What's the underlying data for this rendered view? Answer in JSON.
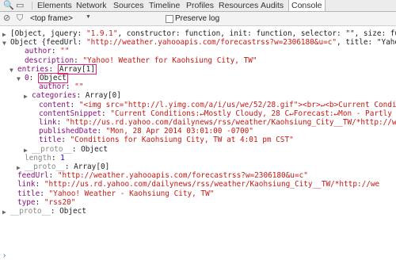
{
  "tabs": [
    "Elements",
    "Network",
    "Sources",
    "Timeline",
    "Profiles",
    "Resources",
    "Audits",
    "Console"
  ],
  "toolbar": {
    "frame": "<top frame>",
    "preserve_log": "Preserve log"
  },
  "lines": [
    {
      "ind": 1,
      "arrow": "right",
      "pre": "[Object, jquery: ",
      "val": "\"1.9.1\"",
      "vc": "s",
      "post": ", constructor: function, init: function, selector: \"\", size: fu"
    },
    {
      "ind": 1,
      "arrow": "down",
      "pre": "Object {feedUrl: ",
      "val": "\"http://weather.yahooapis.com/forecastrss?w=2306180&u=c\"",
      "vc": "s",
      "post": ", title: \"Yaho"
    },
    {
      "ind": 3,
      "key": "author",
      "val": "\"\"",
      "vc": "s"
    },
    {
      "ind": 3,
      "key": "description",
      "val": "\"Yahoo! Weather for Kaohsiung City, TW\"",
      "vc": "s"
    },
    {
      "ind": 2,
      "arrow": "down",
      "key": "entries",
      "val": "Array[1]",
      "vc": "hl"
    },
    {
      "ind": 3,
      "arrow": "down",
      "key": "0",
      "val": "Object",
      "vc": "hl"
    },
    {
      "ind": 5,
      "key": "author",
      "val": "\"\"",
      "vc": "s"
    },
    {
      "ind": 4,
      "arrow": "right",
      "key": "categories",
      "val": "Array[0]",
      "vc": ""
    },
    {
      "ind": 5,
      "key": "content",
      "val": "\"<img src=\"http://l.yimg.com/a/i/us/we/52/28.gif\"><br>↵<b>Current Conditi",
      "vc": "s"
    },
    {
      "ind": 5,
      "key": "contentSnippet",
      "val": "\"Current Conditions:↵Mostly Cloudy, 28 C↵Forecast:↵Mon - Partly",
      "vc": "s"
    },
    {
      "ind": 5,
      "key": "link",
      "val": "\"http://us.rd.yahoo.com/dailynews/rss/weather/Kaohsiung_City__TW/*http://w",
      "vc": "s"
    },
    {
      "ind": 5,
      "key": "publishedDate",
      "val": "\"Mon, 28 Apr 2014 03:01:00 -0700\"",
      "vc": "s"
    },
    {
      "ind": 5,
      "key": "title",
      "val": "\"Conditions for Kaohsiung City, TW at 4:01 pm CST\"",
      "vc": "s"
    },
    {
      "ind": 4,
      "arrow": "right",
      "key": "__proto__",
      "val": "Object",
      "vc": "",
      "kc": "dim"
    },
    {
      "ind": 3,
      "key": "length",
      "val": "1",
      "vc": "n",
      "kc": "dim"
    },
    {
      "ind": 3,
      "arrow": "right",
      "key": "__proto__",
      "val": "Array[0]",
      "vc": "",
      "kc": "dim"
    },
    {
      "ind": 2,
      "key": "feedUrl",
      "val": "\"http://weather.yahooapis.com/forecastrss?w=2306180&u=c\"",
      "vc": "s"
    },
    {
      "ind": 2,
      "key": "link",
      "val": "\"http://us.rd.yahoo.com/dailynews/rss/weather/Kaohsiung_City__TW/*http://we",
      "vc": "s"
    },
    {
      "ind": 2,
      "key": "title",
      "val": "\"Yahoo! Weather - Kaohsiung City, TW\"",
      "vc": "s"
    },
    {
      "ind": 2,
      "key": "type",
      "val": "\"rss20\"",
      "vc": "s"
    },
    {
      "ind": 1,
      "arrow": "right",
      "key": "__proto__",
      "val": "Object",
      "vc": "",
      "kc": "dim"
    }
  ],
  "prompt": "›"
}
